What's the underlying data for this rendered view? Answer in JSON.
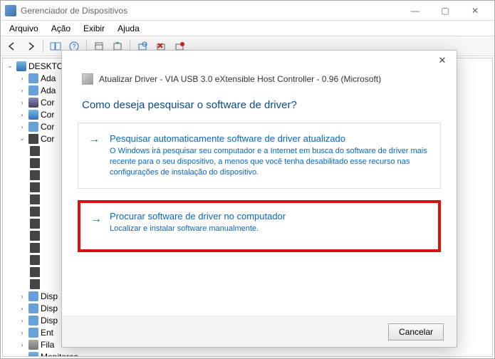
{
  "window": {
    "title": "Gerenciador de Dispositivos",
    "controls": {
      "min": "—",
      "max": "▢",
      "close": "✕"
    }
  },
  "menubar": [
    "Arquivo",
    "Ação",
    "Exibir",
    "Ajuda"
  ],
  "tree": {
    "root": "DESKTO",
    "nodes": [
      "Ada",
      "Ada",
      "Cor",
      "Cor",
      "Cor",
      "Cor"
    ],
    "bottom_nodes": [
      "Disp",
      "Disp",
      "Disp",
      "Ent",
      "Fila",
      "Monitores"
    ]
  },
  "dialog": {
    "title": "Atualizar Driver -  VIA USB 3.0 eXtensible Host Controller - 0.96 (Microsoft)",
    "question": "Como deseja pesquisar o software de driver?",
    "option1": {
      "title": "Pesquisar automaticamente software de driver atualizado",
      "desc": "O Windows irá pesquisar seu computador e a Internet em busca do software de driver mais recente para o seu dispositivo, a menos que você tenha desabilitado esse recurso nas configurações de instalação do dispositivo."
    },
    "option2": {
      "title": "Procurar software de driver no computador",
      "desc": "Localizar e instalar software manualmente."
    },
    "cancel": "Cancelar"
  }
}
